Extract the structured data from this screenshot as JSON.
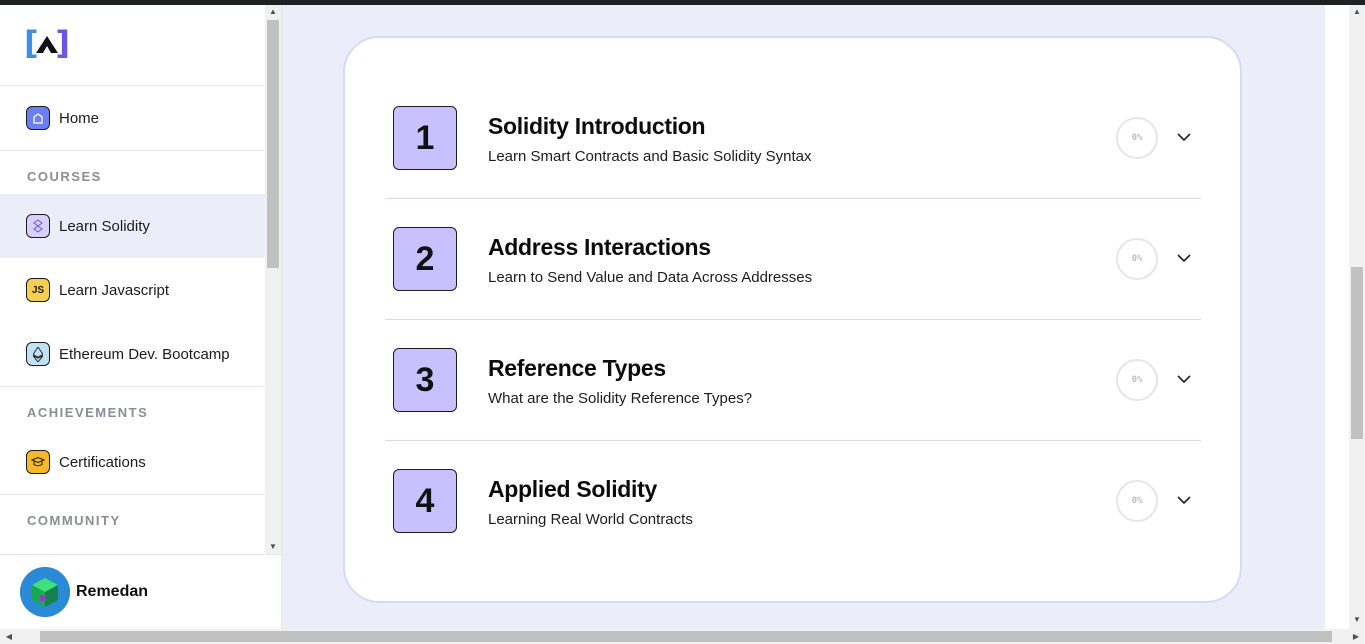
{
  "sidebar": {
    "logo_alt": "AU",
    "home": "Home",
    "sections": {
      "courses": "COURSES",
      "achievements": "ACHIEVEMENTS",
      "community": "COMMUNITY"
    },
    "courses": [
      {
        "label": "Learn Solidity",
        "icon": "solidity-icon",
        "active": true
      },
      {
        "label": "Learn Javascript",
        "icon": "javascript-icon",
        "active": false
      },
      {
        "label": "Ethereum Dev. Bootcamp",
        "icon": "ethereum-icon",
        "active": false
      }
    ],
    "achievements": [
      {
        "label": "Certifications",
        "icon": "certificate-icon"
      }
    ],
    "js_glyph": "JS"
  },
  "user": {
    "name": "Remedan"
  },
  "courses": [
    {
      "number": "1",
      "title": "Solidity Introduction",
      "subtitle": "Learn Smart Contracts and Basic Solidity Syntax",
      "progress": "0%"
    },
    {
      "number": "2",
      "title": "Address Interactions",
      "subtitle": "Learn to Send Value and Data Across Addresses",
      "progress": "0%"
    },
    {
      "number": "3",
      "title": "Reference Types",
      "subtitle": "What are the Solidity Reference Types?",
      "progress": "0%"
    },
    {
      "number": "4",
      "title": "Applied Solidity",
      "subtitle": "Learning Real World Contracts",
      "progress": "0%"
    }
  ],
  "colors": {
    "accent_purple": "#c9c1ff",
    "page_bg": "#ebeef8",
    "card_border": "#d5daf5"
  }
}
